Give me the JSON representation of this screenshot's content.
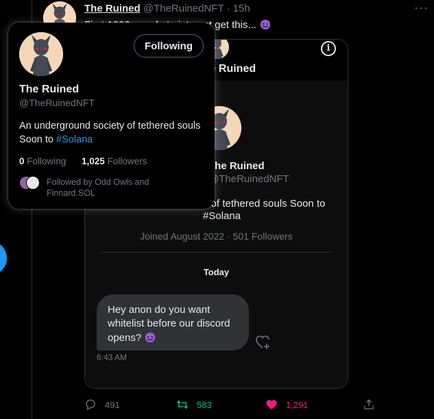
{
  "tweet": {
    "author_name": "The Ruined",
    "author_handle": "@TheRuinedNFT",
    "separator": "·",
    "time": "15h",
    "text": "First 1000 people to interact get this...",
    "more_icon": "more-horizontal-icon"
  },
  "card": {
    "title": "The Ruined",
    "profile_name": "The Ruined",
    "profile_handle": "@TheRuinedNFT",
    "bio_visible": "y of tethered souls Soon to #Solana",
    "joined": "Joined August 2022 · 501 Followers",
    "day_label": "Today",
    "message": {
      "text": "Hey anon do you want whitelist before our discord opens?",
      "time": "6:43 AM"
    },
    "info_icon": "info-icon"
  },
  "actions": {
    "replies": "491",
    "retweets": "583",
    "likes": "1,291"
  },
  "hovercard": {
    "name": "The Ruined",
    "handle": "@TheRuinedNFT",
    "follow_button": "Following",
    "bio_text": "An underground society of tethered souls Soon to ",
    "bio_hashtag": "#Solana",
    "following_count": "0",
    "following_label": "Following",
    "followers_count": "1,025",
    "followers_label": "Followers",
    "mutuals": "Followed by Odd Owls and Finnard.SOL"
  },
  "colors": {
    "accent": "#1d9bf0",
    "retweet": "#00ba7c",
    "like": "#f91880",
    "muted": "#71767b",
    "text": "#e7e9ea"
  }
}
